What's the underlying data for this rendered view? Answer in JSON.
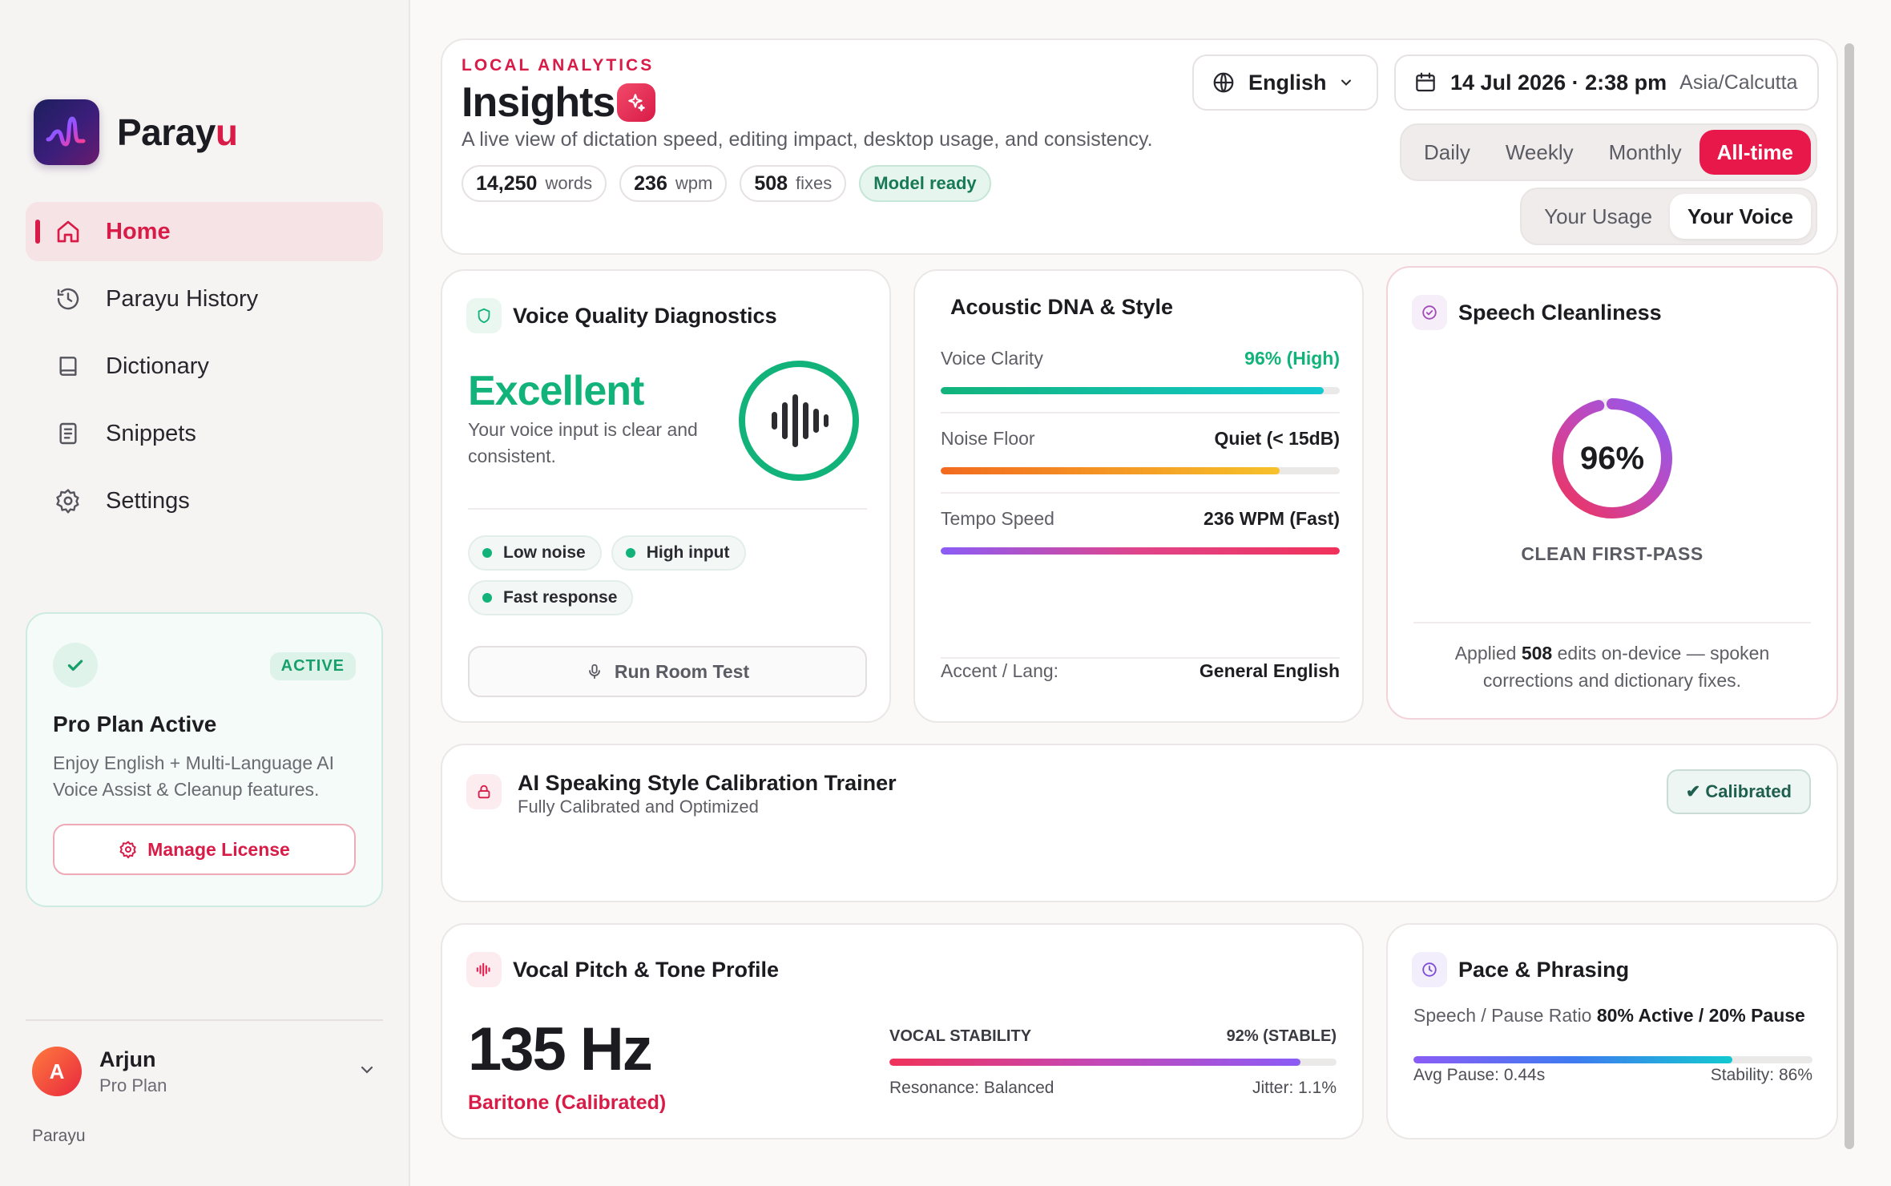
{
  "sidebar": {
    "brand": {
      "name_main": "Paray",
      "name_accent": "u"
    },
    "nav": [
      {
        "label": "Home",
        "icon": "home-icon",
        "active": true
      },
      {
        "label": "Parayu History",
        "icon": "history-icon"
      },
      {
        "label": "Dictionary",
        "icon": "book-icon"
      },
      {
        "label": "Snippets",
        "icon": "document-icon"
      },
      {
        "label": "Settings",
        "icon": "gear-icon"
      }
    ],
    "plan": {
      "badge": "ACTIVE",
      "title": "Pro Plan Active",
      "description": "Enjoy English + Multi-Language AI Voice Assist & Cleanup features.",
      "button": "Manage License"
    },
    "user": {
      "initial": "A",
      "name": "Arjun",
      "plan": "Pro Plan"
    },
    "footer": "Parayu"
  },
  "header": {
    "eyebrow": "LOCAL ANALYTICS",
    "title": "Insights",
    "subtitle": "A live view of dictation speed, editing impact, desktop usage, and consistency.",
    "stats": [
      {
        "value": "14,250",
        "unit": "words"
      },
      {
        "value": "236",
        "unit": "wpm"
      },
      {
        "value": "508",
        "unit": "fixes"
      }
    ],
    "status_chip": "Model ready",
    "language": "English",
    "datetime": "14 Jul 2026 · 2:38 pm",
    "timezone": "Asia/Calcutta",
    "periods": [
      "Daily",
      "Weekly",
      "Monthly",
      "All-time"
    ],
    "active_period": "All-time",
    "views": [
      "Your Usage",
      "Your Voice"
    ],
    "active_view": "Your Voice"
  },
  "voice_quality": {
    "title": "Voice Quality Diagnostics",
    "rating": "Excellent",
    "description": "Your voice input is clear and consistent.",
    "tags": [
      "Low noise",
      "High input",
      "Fast response"
    ],
    "button": "Run Room Test"
  },
  "acoustic": {
    "title": "Acoustic DNA & Style",
    "metrics": [
      {
        "label": "Voice Clarity",
        "value": "96% (High)",
        "fill": 0.96
      },
      {
        "label": "Noise Floor",
        "value": "Quiet (< 15dB)",
        "fill": 0.85
      },
      {
        "label": "Tempo Speed",
        "value": "236 WPM (Fast)",
        "fill": 1.0
      }
    ],
    "accent_label": "Accent / Lang:",
    "accent_value": "General English"
  },
  "cleanliness": {
    "title": "Speech Cleanliness",
    "percent_label": "96%",
    "percent": 96,
    "caption": "CLEAN FIRST-PASS",
    "desc_pre": "Applied ",
    "desc_count": "508",
    "desc_post": " edits on-device — spoken corrections and dictionary fixes."
  },
  "trainer": {
    "title": "AI Speaking Style Calibration Trainer",
    "subtitle": "Fully Calibrated and Optimized",
    "status": "✔ Calibrated"
  },
  "pitch": {
    "title": "Vocal Pitch & Tone Profile",
    "frequency": "135 Hz",
    "type": "Baritone (Calibrated)",
    "stability_label": "VOCAL STABILITY",
    "stability_value": "92% (STABLE)",
    "stability_fill": 0.92,
    "resonance": "Resonance: Balanced",
    "jitter": "Jitter: 1.1%"
  },
  "pace": {
    "title": "Pace & Phrasing",
    "ratio_label": "Speech / Pause Ratio",
    "ratio_value": "80% Active / 20% Pause",
    "active_fill": 0.8,
    "avg_pause": "Avg Pause: 0.44s",
    "stability": "Stability: 86%"
  },
  "colors": {
    "accent": "#d81b47",
    "success": "#12b37b",
    "purple": "#8b5cf6"
  }
}
